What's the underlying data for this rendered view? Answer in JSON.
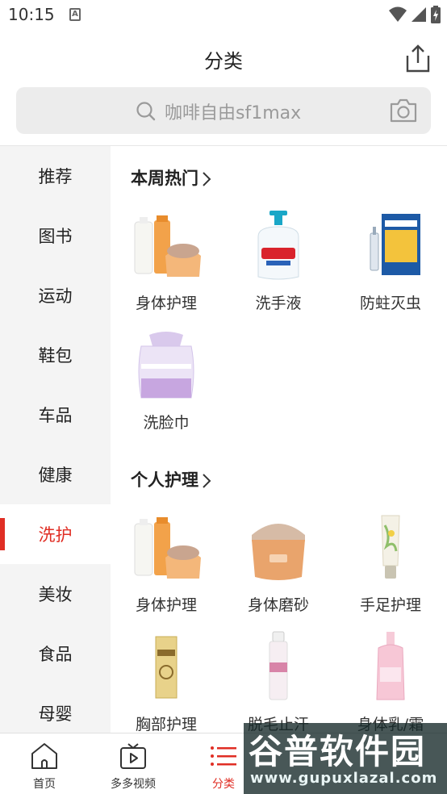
{
  "status_bar": {
    "time": "10:15",
    "notif_letter": "A"
  },
  "header": {
    "title": "分类"
  },
  "search": {
    "placeholder": "咖啡自由sf1max"
  },
  "sidebar": {
    "items": [
      {
        "label": "推荐"
      },
      {
        "label": "图书"
      },
      {
        "label": "运动"
      },
      {
        "label": "鞋包"
      },
      {
        "label": "车品"
      },
      {
        "label": "健康"
      },
      {
        "label": "洗护",
        "active": true
      },
      {
        "label": "美妆"
      },
      {
        "label": "食品"
      },
      {
        "label": "母婴"
      }
    ]
  },
  "sections": [
    {
      "title": "本周热门",
      "products": [
        {
          "label": "身体护理",
          "icon": "skincare-set-icon"
        },
        {
          "label": "洗手液",
          "icon": "hand-soap-bottle-icon"
        },
        {
          "label": "防蛀灭虫",
          "icon": "insecticide-box-icon"
        },
        {
          "label": "洗脸巾",
          "icon": "face-towel-roll-icon"
        }
      ]
    },
    {
      "title": "个人护理",
      "products": [
        {
          "label": "身体护理",
          "icon": "skincare-set-icon"
        },
        {
          "label": "身体磨砂",
          "icon": "body-scrub-jar-icon"
        },
        {
          "label": "手足护理",
          "icon": "hand-cream-tube-icon"
        },
        {
          "label": "胸部护理",
          "icon": "cream-box-icon"
        },
        {
          "label": "脱毛止汗",
          "icon": "spray-can-icon"
        },
        {
          "label": "身体乳/霜",
          "icon": "lotion-bottle-icon"
        }
      ]
    }
  ],
  "tabs": [
    {
      "label": "首页",
      "icon": "home-icon"
    },
    {
      "label": "多多视频",
      "icon": "video-icon"
    },
    {
      "label": "分类",
      "icon": "category-list-icon",
      "active": true
    }
  ],
  "watermark": {
    "title": "谷普软件园",
    "url": "www.gupuxlazal.com"
  },
  "colors": {
    "accent": "#e02e24",
    "sidebar_bg": "#f4f4f4",
    "search_bg": "#ececec"
  }
}
